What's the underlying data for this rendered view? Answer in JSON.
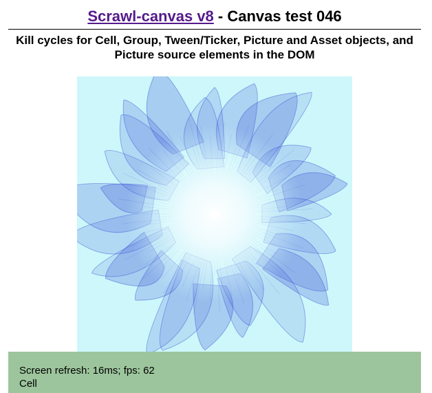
{
  "header": {
    "link_text": "Scrawl-canvas v8",
    "title_rest": " - Canvas test 046",
    "subtitle": "Kill cycles for Cell, Group, Tween/Ticker, Picture and Asset objects, and Picture source elements in the DOM"
  },
  "report": {
    "line1": "Screen refresh: 16ms; fps: 62",
    "line2": "Cell"
  },
  "colors": {
    "link": "#551a8b",
    "canvas_background": "#cdf7fa",
    "stroke_blue": "#3a55d6",
    "center_glow": "#ffffff",
    "report_background": "#9dc59d"
  }
}
